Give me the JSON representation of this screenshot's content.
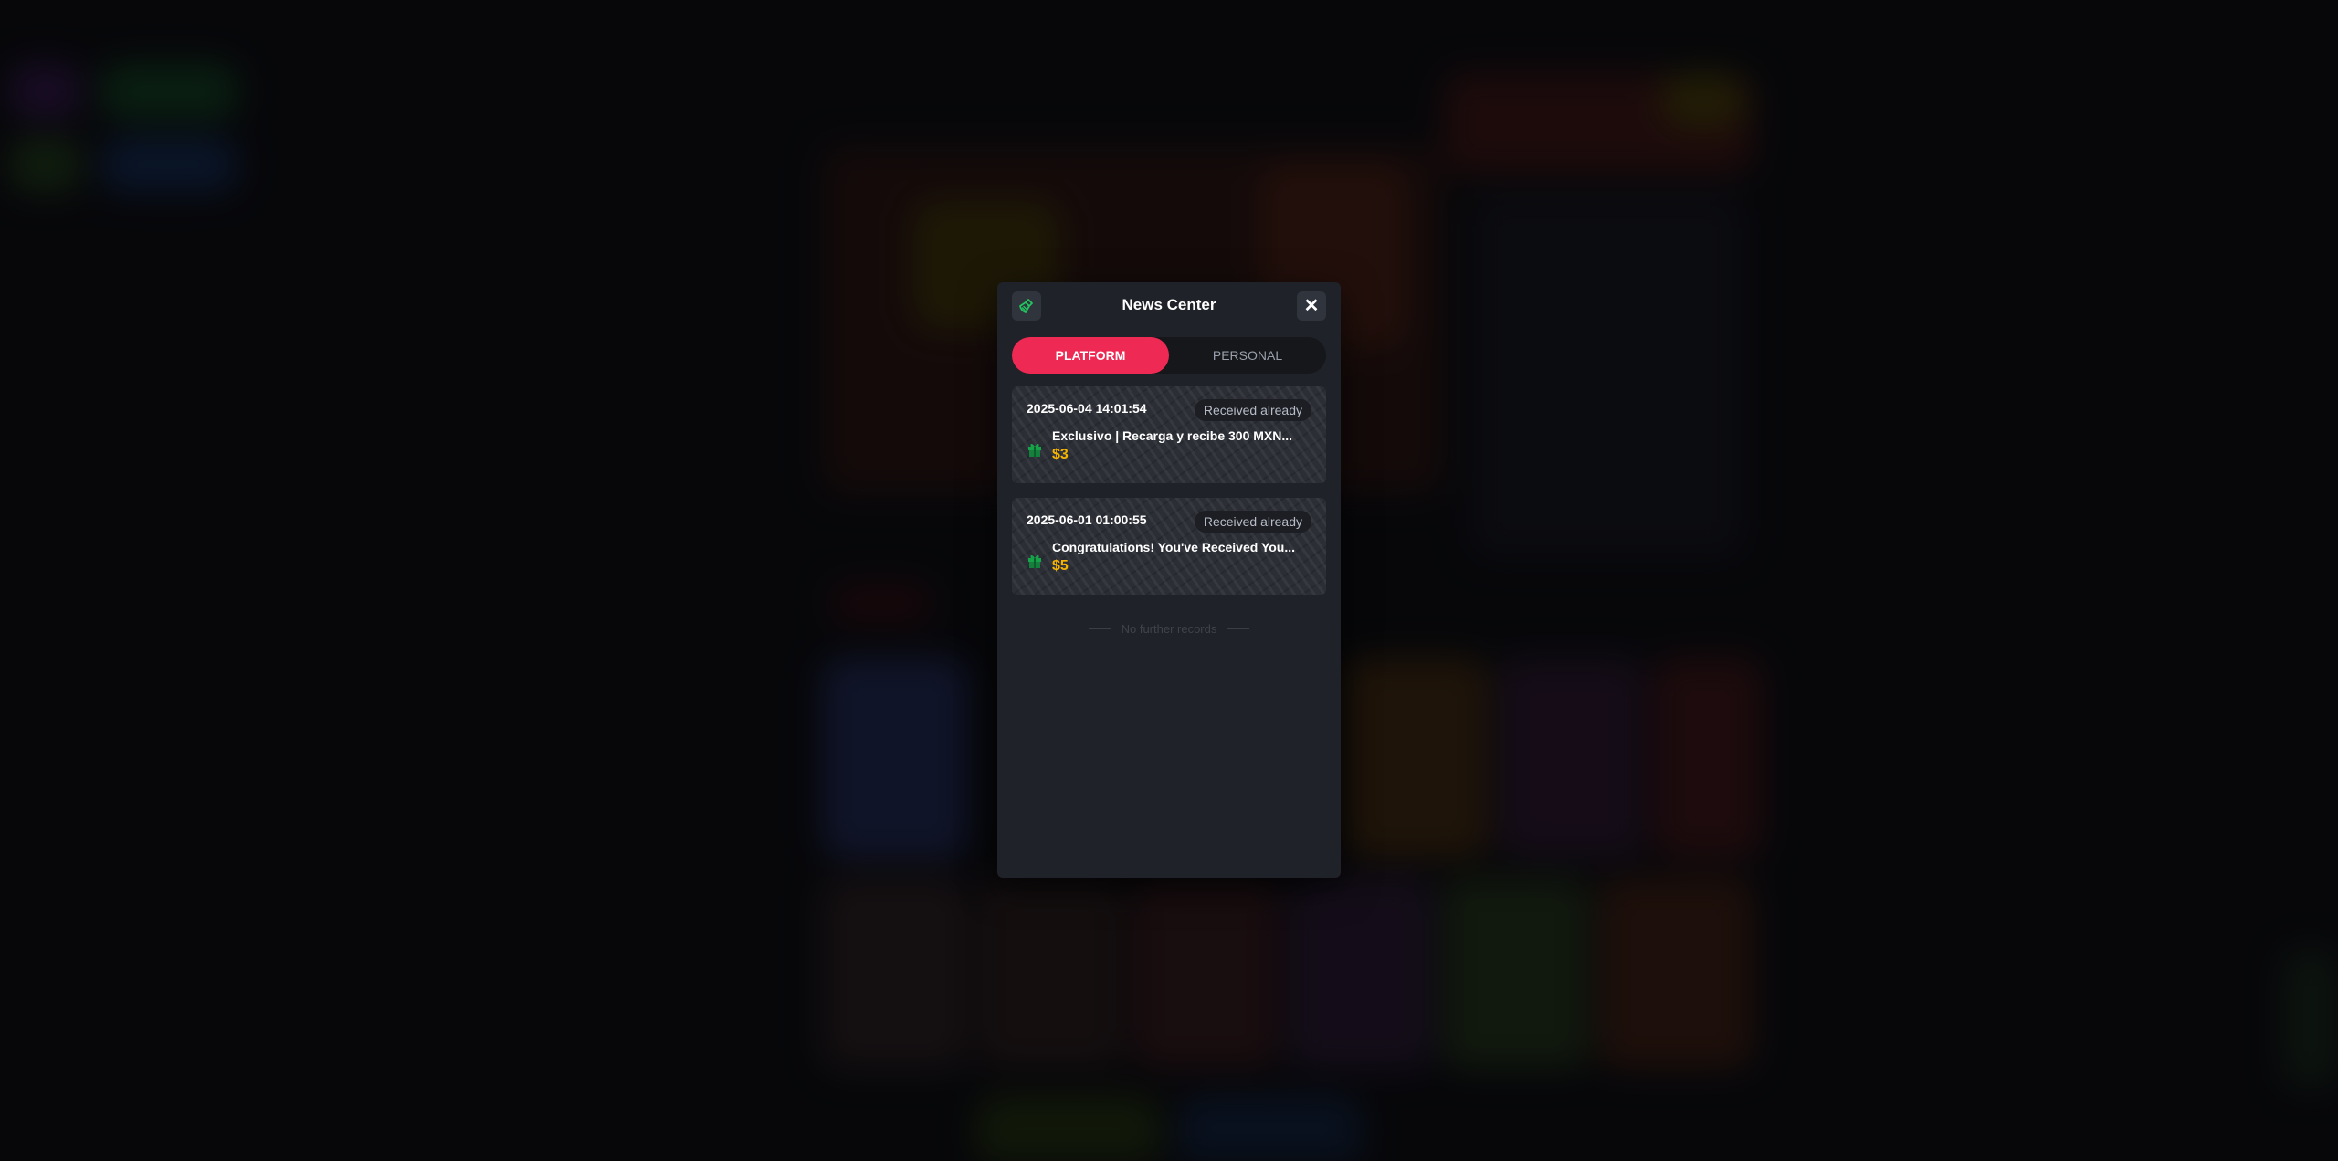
{
  "modal": {
    "title": "News Center",
    "tabs": [
      {
        "label": "PLATFORM",
        "active": true
      },
      {
        "label": "PERSONAL",
        "active": false
      }
    ],
    "messages": [
      {
        "time": "2025-06-04 14:01:54",
        "status": "Received already",
        "title": "Exclusivo | Recarga y recibe 300 MXN...",
        "amount": "$3",
        "icon": "gift-icon"
      },
      {
        "time": "2025-06-01 01:00:55",
        "status": "Received already",
        "title": "Congratulations! You've Received You...",
        "amount": "$5",
        "icon": "gift-icon"
      }
    ],
    "end_note": "No further records"
  },
  "colors": {
    "accent": "#ee2a54",
    "amount": "#f7b500",
    "gift": "#16a34a",
    "modal_bg": "#1f2228"
  }
}
